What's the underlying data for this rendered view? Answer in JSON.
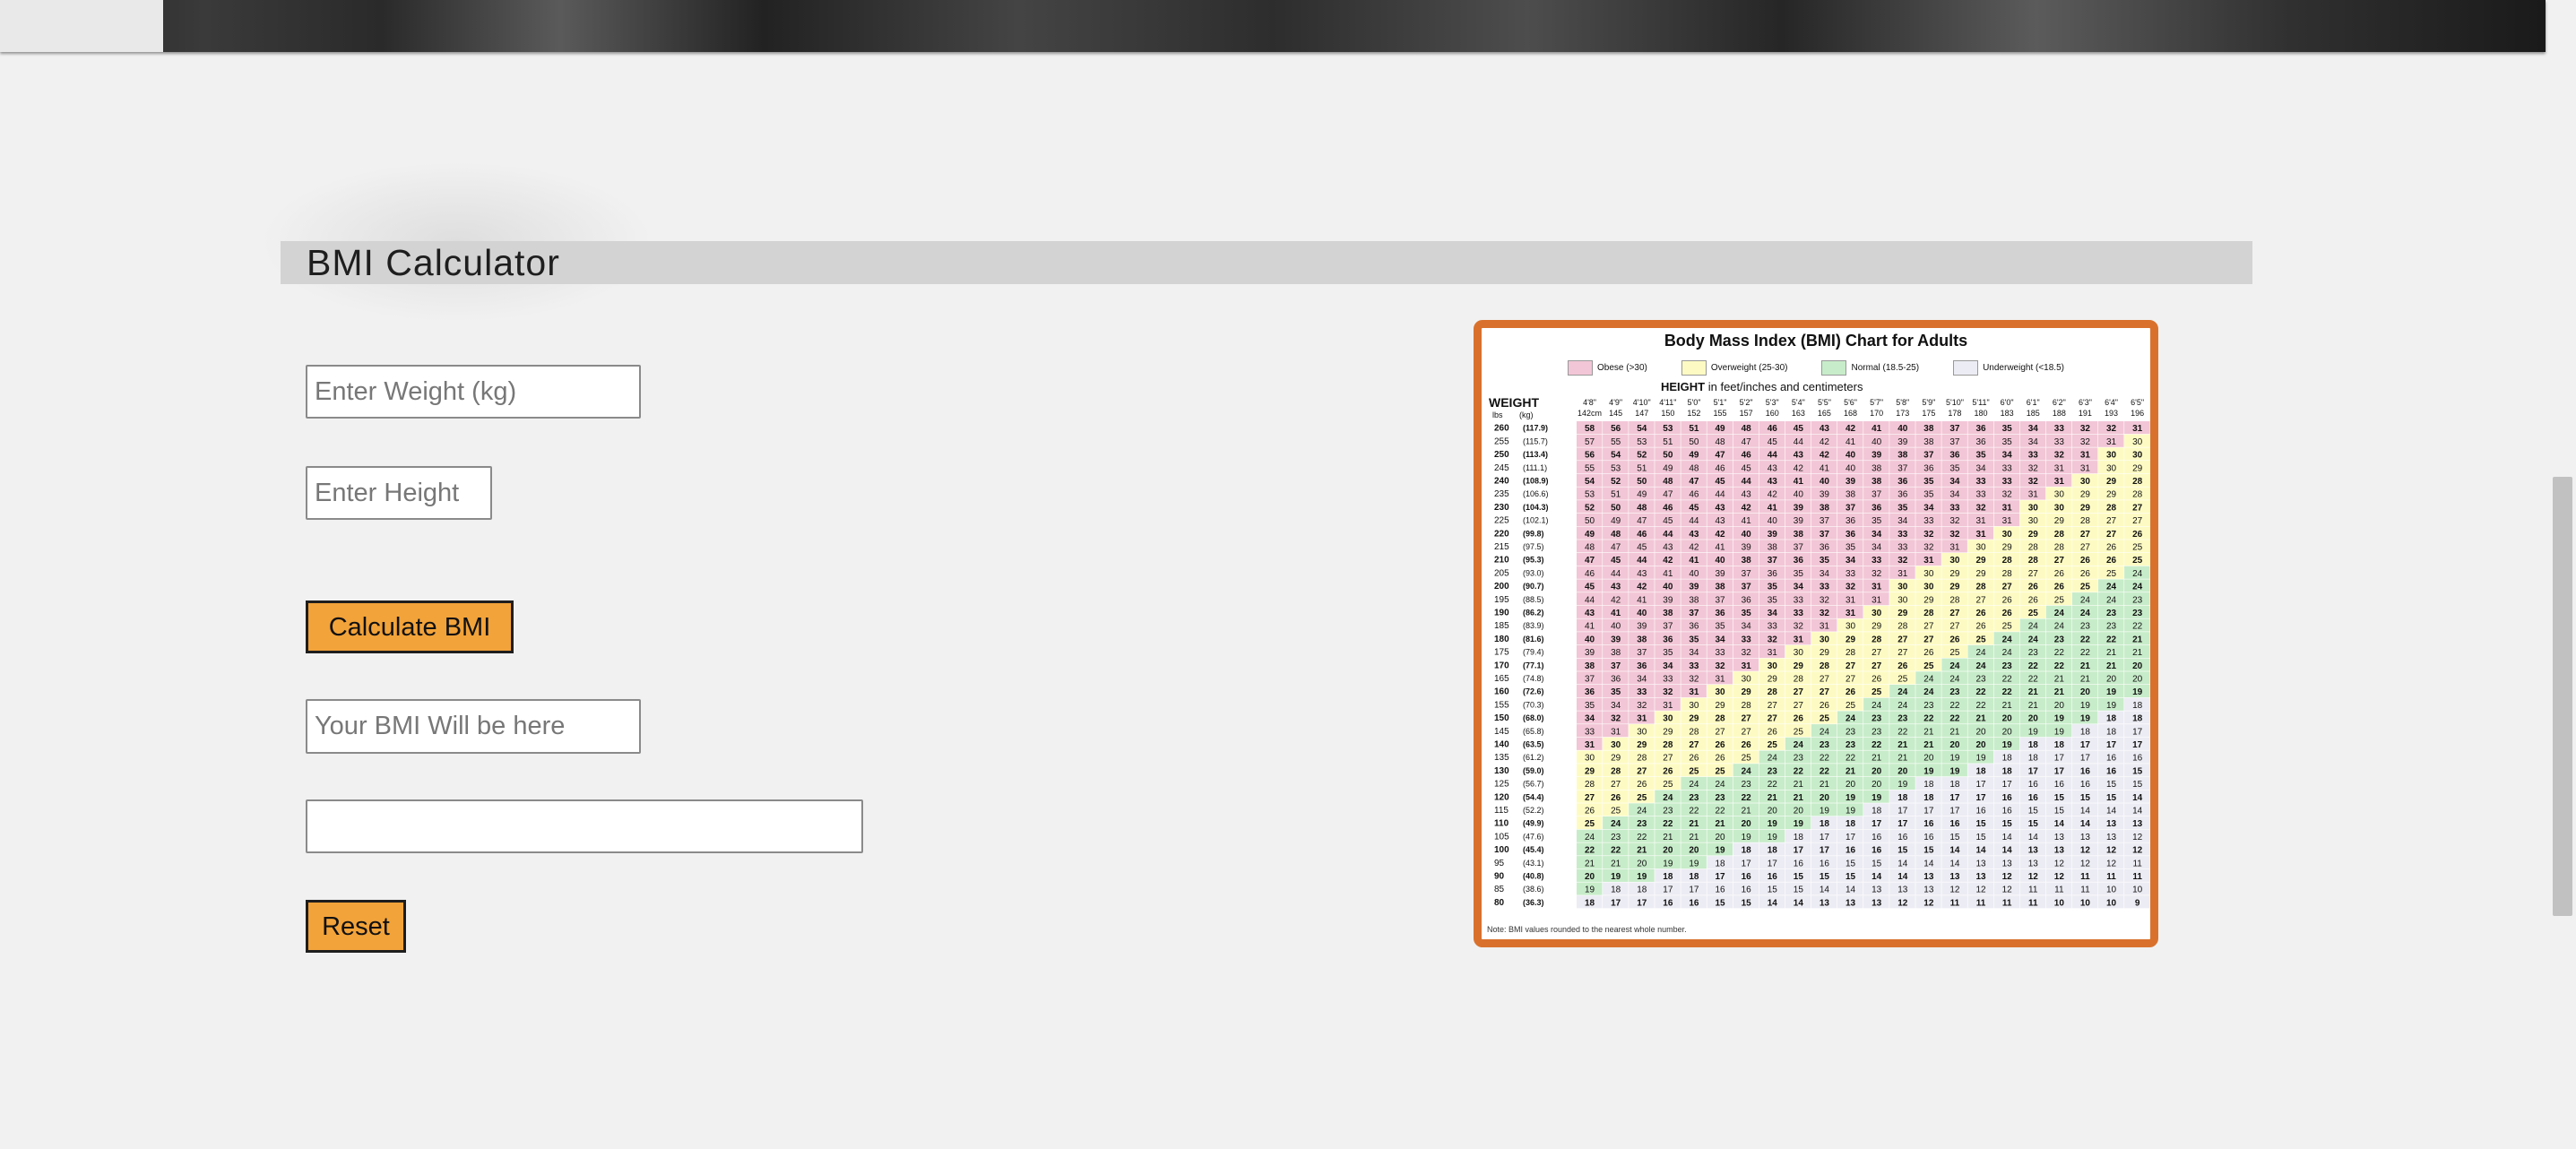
{
  "page": {
    "title": "BMI Calculator"
  },
  "form": {
    "weight_placeholder": "Enter Weight (kg)",
    "height_placeholder": "Enter Height",
    "calculate_label": "Calculate BMI",
    "result_placeholder": "Your BMI Will be here",
    "category_value": "",
    "reset_label": "Reset"
  },
  "colors": {
    "button": "#f2a33a",
    "chart_border": "#d9712d",
    "obese": "#f2c6d6",
    "overweight": "#fdfbc3",
    "normal": "#c7ecc9",
    "underweight": "#ececf4"
  },
  "chart": {
    "title": "Body Mass Index (BMI) Chart for Adults",
    "legend": [
      {
        "label": "Obese (>30)",
        "key": "obese"
      },
      {
        "label": "Overweight (25-30)",
        "key": "overweight"
      },
      {
        "label": "Normal (18.5-25)",
        "key": "normal"
      },
      {
        "label": "Underweight (<18.5)",
        "key": "underweight"
      }
    ],
    "height_label_bold": "HEIGHT",
    "height_label_rest": " in feet/inches and centimeters",
    "weight_label": "WEIGHT",
    "weight_units": [
      "lbs",
      "(kg)"
    ],
    "heights_ft": [
      "4'8\"",
      "4'9\"",
      "4'10\"",
      "4'11\"",
      "5'0\"",
      "5'1\"",
      "5'2\"",
      "5'3\"",
      "5'4\"",
      "5'5\"",
      "5'6\"",
      "5'7\"",
      "5'8\"",
      "5'9\"",
      "5'10\"",
      "5'11\"",
      "6'0\"",
      "6'1\"",
      "6'2\"",
      "6'3\"",
      "6'4\"",
      "6'5\""
    ],
    "heights_cm": [
      "142cm",
      "145",
      "147",
      "150",
      "152",
      "155",
      "157",
      "160",
      "163",
      "165",
      "168",
      "170",
      "173",
      "175",
      "178",
      "180",
      "183",
      "185",
      "188",
      "191",
      "193",
      "196"
    ],
    "weights_lbs": [
      260,
      255,
      250,
      245,
      240,
      235,
      230,
      225,
      220,
      215,
      210,
      205,
      200,
      195,
      190,
      185,
      180,
      175,
      170,
      165,
      160,
      155,
      150,
      145,
      140,
      135,
      130,
      125,
      120,
      115,
      110,
      105,
      100,
      95,
      90,
      85,
      80
    ],
    "weights_kg": [
      "(117.9)",
      "(115.7)",
      "(113.4)",
      "(111.1)",
      "(108.9)",
      "(106.6)",
      "(104.3)",
      "(102.1)",
      "(99.8)",
      "(97.5)",
      "(95.3)",
      "(93.0)",
      "(90.7)",
      "(88.5)",
      "(86.2)",
      "(83.9)",
      "(81.6)",
      "(79.4)",
      "(77.1)",
      "(74.8)",
      "(72.6)",
      "(70.3)",
      "(68.0)",
      "(65.8)",
      "(63.5)",
      "(61.2)",
      "(59.0)",
      "(56.7)",
      "(54.4)",
      "(52.2)",
      "(49.9)",
      "(47.6)",
      "(45.4)",
      "(43.1)",
      "(40.8)",
      "(38.6)",
      "(36.3)"
    ],
    "rows": [
      [
        58,
        56,
        54,
        53,
        51,
        49,
        48,
        46,
        45,
        43,
        42,
        41,
        40,
        38,
        37,
        36,
        35,
        34,
        33,
        32,
        32,
        31
      ],
      [
        57,
        55,
        53,
        51,
        50,
        48,
        47,
        45,
        44,
        42,
        41,
        40,
        39,
        38,
        37,
        36,
        35,
        34,
        33,
        32,
        31,
        30
      ],
      [
        56,
        54,
        52,
        50,
        49,
        47,
        46,
        44,
        43,
        42,
        40,
        39,
        38,
        37,
        36,
        35,
        34,
        33,
        32,
        31,
        30,
        30
      ],
      [
        55,
        53,
        51,
        49,
        48,
        46,
        45,
        43,
        42,
        41,
        40,
        38,
        37,
        36,
        35,
        34,
        33,
        32,
        31,
        31,
        30,
        29
      ],
      [
        54,
        52,
        50,
        48,
        47,
        45,
        44,
        43,
        41,
        40,
        39,
        38,
        36,
        35,
        34,
        33,
        33,
        32,
        31,
        30,
        29,
        28
      ],
      [
        53,
        51,
        49,
        47,
        46,
        44,
        43,
        42,
        40,
        39,
        38,
        37,
        36,
        35,
        34,
        33,
        32,
        31,
        30,
        29,
        29,
        28
      ],
      [
        52,
        50,
        48,
        46,
        45,
        43,
        42,
        41,
        39,
        38,
        37,
        36,
        35,
        34,
        33,
        32,
        31,
        30,
        30,
        29,
        28,
        27
      ],
      [
        50,
        49,
        47,
        45,
        44,
        43,
        41,
        40,
        39,
        37,
        36,
        35,
        34,
        33,
        32,
        31,
        31,
        30,
        29,
        28,
        27,
        27
      ],
      [
        49,
        48,
        46,
        44,
        43,
        42,
        40,
        39,
        38,
        37,
        36,
        34,
        33,
        32,
        32,
        31,
        30,
        29,
        28,
        27,
        27,
        26
      ],
      [
        48,
        47,
        45,
        43,
        42,
        41,
        39,
        38,
        37,
        36,
        35,
        34,
        33,
        32,
        31,
        30,
        29,
        28,
        28,
        27,
        26,
        25
      ],
      [
        47,
        45,
        44,
        42,
        41,
        40,
        38,
        37,
        36,
        35,
        34,
        33,
        32,
        31,
        30,
        29,
        28,
        28,
        27,
        26,
        26,
        25
      ],
      [
        46,
        44,
        43,
        41,
        40,
        39,
        37,
        36,
        35,
        34,
        33,
        32,
        31,
        30,
        29,
        29,
        28,
        27,
        26,
        26,
        25,
        24
      ],
      [
        45,
        43,
        42,
        40,
        39,
        38,
        37,
        35,
        34,
        33,
        32,
        31,
        30,
        30,
        29,
        28,
        27,
        26,
        26,
        25,
        24,
        24
      ],
      [
        44,
        42,
        41,
        39,
        38,
        37,
        36,
        35,
        33,
        32,
        31,
        31,
        30,
        29,
        28,
        27,
        26,
        26,
        25,
        24,
        24,
        23
      ],
      [
        43,
        41,
        40,
        38,
        37,
        36,
        35,
        34,
        33,
        32,
        31,
        30,
        29,
        28,
        27,
        26,
        26,
        25,
        24,
        24,
        23,
        23
      ],
      [
        41,
        40,
        39,
        37,
        36,
        35,
        34,
        33,
        32,
        31,
        30,
        29,
        28,
        27,
        27,
        26,
        25,
        24,
        24,
        23,
        23,
        22
      ],
      [
        40,
        39,
        38,
        36,
        35,
        34,
        33,
        32,
        31,
        30,
        29,
        28,
        27,
        27,
        26,
        25,
        24,
        24,
        23,
        22,
        22,
        21
      ],
      [
        39,
        38,
        37,
        35,
        34,
        33,
        32,
        31,
        30,
        29,
        28,
        27,
        27,
        26,
        25,
        24,
        24,
        23,
        22,
        22,
        21,
        21
      ],
      [
        38,
        37,
        36,
        34,
        33,
        32,
        31,
        30,
        29,
        28,
        27,
        27,
        26,
        25,
        24,
        24,
        23,
        22,
        22,
        21,
        21,
        20
      ],
      [
        37,
        36,
        34,
        33,
        32,
        31,
        30,
        29,
        28,
        27,
        27,
        26,
        25,
        24,
        24,
        23,
        22,
        22,
        21,
        21,
        20,
        20
      ],
      [
        36,
        35,
        33,
        32,
        31,
        30,
        29,
        28,
        27,
        27,
        26,
        25,
        24,
        24,
        23,
        22,
        22,
        21,
        21,
        20,
        19,
        19
      ],
      [
        35,
        34,
        32,
        31,
        30,
        29,
        28,
        27,
        27,
        26,
        25,
        24,
        24,
        23,
        22,
        22,
        21,
        21,
        20,
        19,
        19,
        18
      ],
      [
        34,
        32,
        31,
        30,
        29,
        28,
        27,
        27,
        26,
        25,
        24,
        23,
        23,
        22,
        22,
        21,
        20,
        20,
        19,
        19,
        18,
        18
      ],
      [
        33,
        31,
        30,
        29,
        28,
        27,
        27,
        26,
        25,
        24,
        23,
        23,
        22,
        21,
        21,
        20,
        20,
        19,
        19,
        18,
        18,
        17
      ],
      [
        31,
        30,
        29,
        28,
        27,
        26,
        26,
        25,
        24,
        23,
        23,
        22,
        21,
        21,
        20,
        20,
        19,
        18,
        18,
        17,
        17,
        17
      ],
      [
        30,
        29,
        28,
        27,
        26,
        26,
        25,
        24,
        23,
        22,
        22,
        21,
        21,
        20,
        19,
        19,
        18,
        18,
        17,
        17,
        16,
        16
      ],
      [
        29,
        28,
        27,
        26,
        25,
        25,
        24,
        23,
        22,
        22,
        21,
        20,
        20,
        19,
        19,
        18,
        18,
        17,
        17,
        16,
        16,
        15
      ],
      [
        28,
        27,
        26,
        25,
        24,
        24,
        23,
        22,
        21,
        21,
        20,
        20,
        19,
        18,
        18,
        17,
        17,
        16,
        16,
        16,
        15,
        15
      ],
      [
        27,
        26,
        25,
        24,
        23,
        23,
        22,
        21,
        21,
        20,
        19,
        19,
        18,
        18,
        17,
        17,
        16,
        16,
        15,
        15,
        15,
        14
      ],
      [
        26,
        25,
        24,
        23,
        22,
        22,
        21,
        20,
        20,
        19,
        19,
        18,
        17,
        17,
        17,
        16,
        16,
        15,
        15,
        14,
        14,
        14
      ],
      [
        25,
        24,
        23,
        22,
        21,
        21,
        20,
        19,
        19,
        18,
        18,
        17,
        17,
        16,
        16,
        15,
        15,
        15,
        14,
        14,
        13,
        13
      ],
      [
        24,
        23,
        22,
        21,
        21,
        20,
        19,
        19,
        18,
        17,
        17,
        16,
        16,
        16,
        15,
        15,
        14,
        14,
        13,
        13,
        13,
        12
      ],
      [
        22,
        22,
        21,
        20,
        20,
        19,
        18,
        18,
        17,
        17,
        16,
        16,
        15,
        15,
        14,
        14,
        14,
        13,
        13,
        12,
        12,
        12
      ],
      [
        21,
        21,
        20,
        19,
        19,
        18,
        17,
        17,
        16,
        16,
        15,
        15,
        14,
        14,
        14,
        13,
        13,
        13,
        12,
        12,
        12,
        11
      ],
      [
        20,
        19,
        19,
        18,
        18,
        17,
        16,
        16,
        15,
        15,
        15,
        14,
        14,
        13,
        13,
        13,
        12,
        12,
        12,
        11,
        11,
        11
      ],
      [
        19,
        18,
        18,
        17,
        17,
        16,
        16,
        15,
        15,
        14,
        14,
        13,
        13,
        13,
        12,
        12,
        12,
        11,
        11,
        11,
        10,
        10
      ],
      [
        18,
        17,
        17,
        16,
        16,
        15,
        15,
        14,
        14,
        13,
        13,
        13,
        12,
        12,
        11,
        11,
        11,
        11,
        10,
        10,
        10,
        9
      ]
    ],
    "note": "Note: BMI values rounded to the nearest whole number."
  }
}
